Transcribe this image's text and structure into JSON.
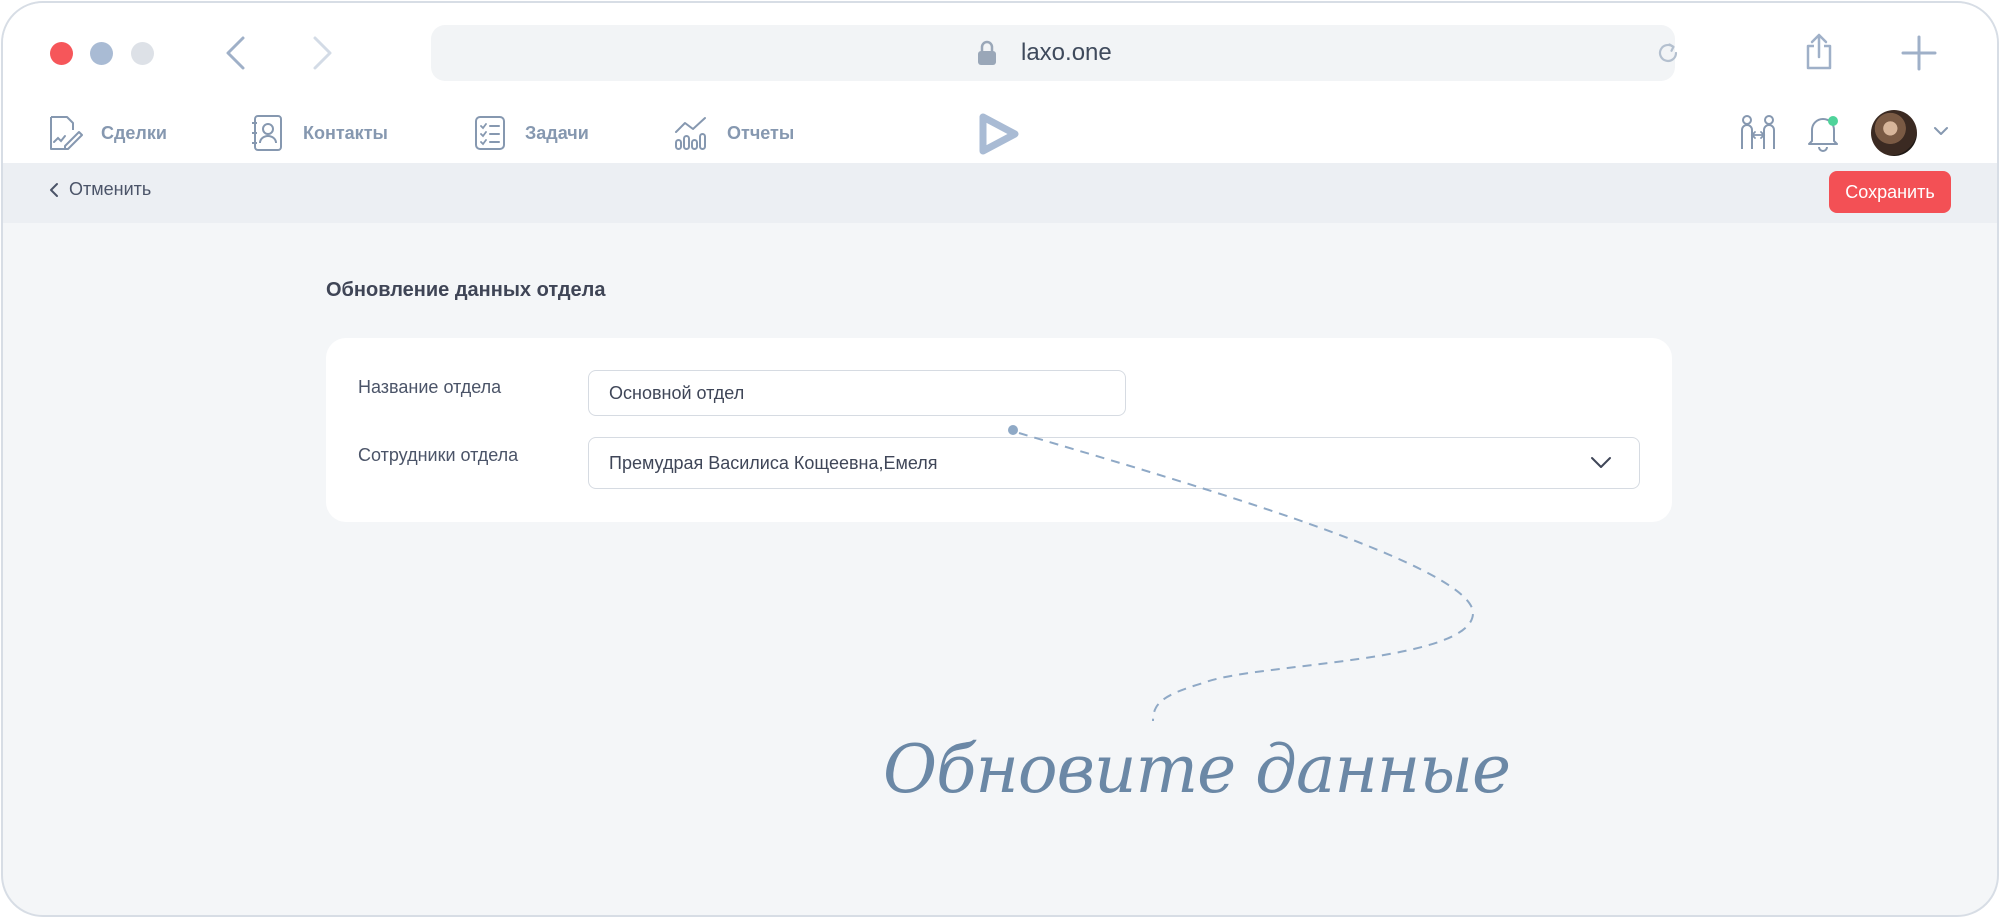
{
  "browser": {
    "url": "laxo.one"
  },
  "nav": {
    "items": [
      {
        "label": "Сделки",
        "icon": "deals-icon"
      },
      {
        "label": "Контакты",
        "icon": "contacts-icon"
      },
      {
        "label": "Задачи",
        "icon": "tasks-icon"
      },
      {
        "label": "Отчеты",
        "icon": "reports-icon"
      }
    ]
  },
  "actions": {
    "cancel_label": "Отменить",
    "save_label": "Сохранить"
  },
  "form": {
    "title": "Обновление данных отдела",
    "name_label": "Название отдела",
    "name_value": "Основной отдел",
    "staff_label": "Сотрудники отдела",
    "staff_value": "Премудрая Василиса Кощеевна,Емеля"
  },
  "annotation": {
    "text": "Обновите данные"
  },
  "colors": {
    "accent": "#f35055",
    "nav_text": "#8698b0",
    "annotation": "#6b88a6"
  }
}
